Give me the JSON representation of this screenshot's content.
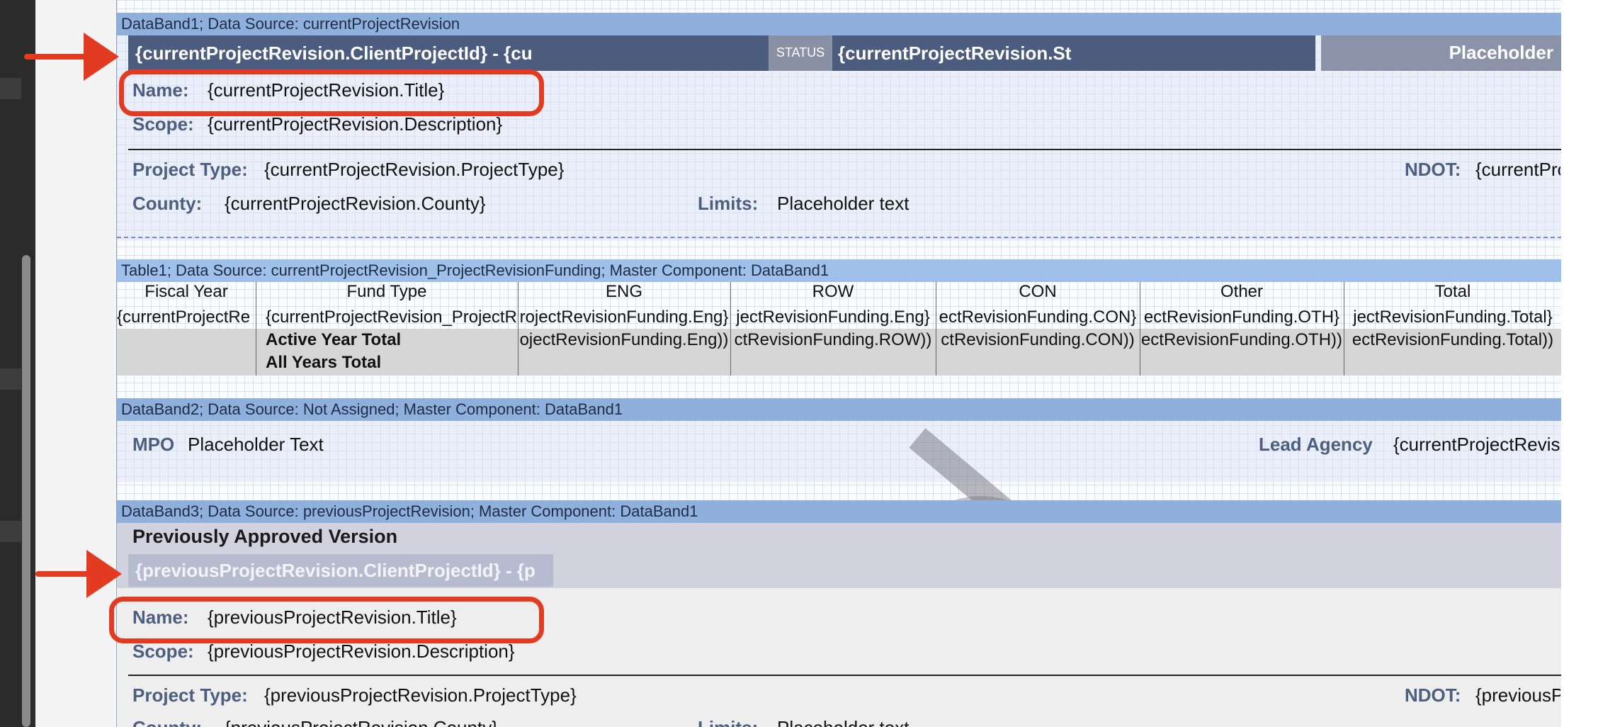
{
  "bands": {
    "databand1": "DataBand1; Data Source: currentProjectRevision",
    "table1": "Table1; Data Source: currentProjectRevision_ProjectRevisionFunding; Master Component: DataBand1",
    "databand2": "DataBand2; Data Source: Not Assigned; Master Component: DataBand1",
    "databand3": "DataBand3; Data Source: previousProjectRevision; Master Component: DataBand1"
  },
  "current": {
    "title_bar": "{currentProjectRevision.ClientProjectId} - {cu",
    "status_chip": "STATUS",
    "status_value": "{currentProjectRevision.St",
    "placeholder": "Placeholder",
    "name_label": "Name:",
    "name_value": "{currentProjectRevision.Title}",
    "scope_label": "Scope:",
    "scope_value": "{currentProjectRevision.Description}",
    "type_label": "Project Type:",
    "type_value": "{currentProjectRevision.ProjectType}",
    "ndot_label": "NDOT:",
    "ndot_value": "{currentPro",
    "county_label": "County:",
    "county_value": "{currentProjectRevision.County}",
    "limits_label": "Limits:",
    "limits_value": "Placeholder text"
  },
  "table": {
    "headers": [
      "Fiscal Year",
      "Fund Type",
      "ENG",
      "ROW",
      "CON",
      "Other",
      "Total"
    ],
    "row1": [
      "{currentProjectRe",
      "{currentProjectRevision_ProjectR",
      "rojectRevisionFunding.Eng}",
      "jectRevisionFunding.Eng}",
      "ectRevisionFunding.CON}",
      "ectRevisionFunding.OTH}",
      "jectRevisionFunding.Total}"
    ],
    "row2": [
      "",
      "Active Year Total",
      "ojectRevisionFunding.Eng))",
      "ctRevisionFunding.ROW))",
      "ctRevisionFunding.CON))",
      "ectRevisionFunding.OTH))",
      "ectRevisionFunding.Total))"
    ],
    "row3_label": "All Years Total"
  },
  "band2": {
    "mpo_label": "MPO",
    "mpo_value": "Placeholder Text",
    "lead_label": "Lead Agency",
    "lead_value": "{currentProjectRevisi"
  },
  "previous": {
    "section_title": "Previously Approved Version",
    "title_bar": "{previousProjectRevision.ClientProjectId} - {p",
    "name_label": "Name:",
    "name_value": "{previousProjectRevision.Title}",
    "scope_label": "Scope:",
    "scope_value": "{previousProjectRevision.Description}",
    "type_label": "Project Type:",
    "type_value": "{previousProjectRevision.ProjectType}",
    "ndot_label": "NDOT:",
    "ndot_value": "{previousP",
    "county_label": "County:",
    "county_value": "{previousProjectRevision.County}",
    "limits_label": "Limits:",
    "limits_value": "Placeholder text"
  },
  "colors": {
    "annotation": "#e23b22",
    "band_header": "#8fb0dc",
    "title_bar": "#4b5c7e"
  }
}
